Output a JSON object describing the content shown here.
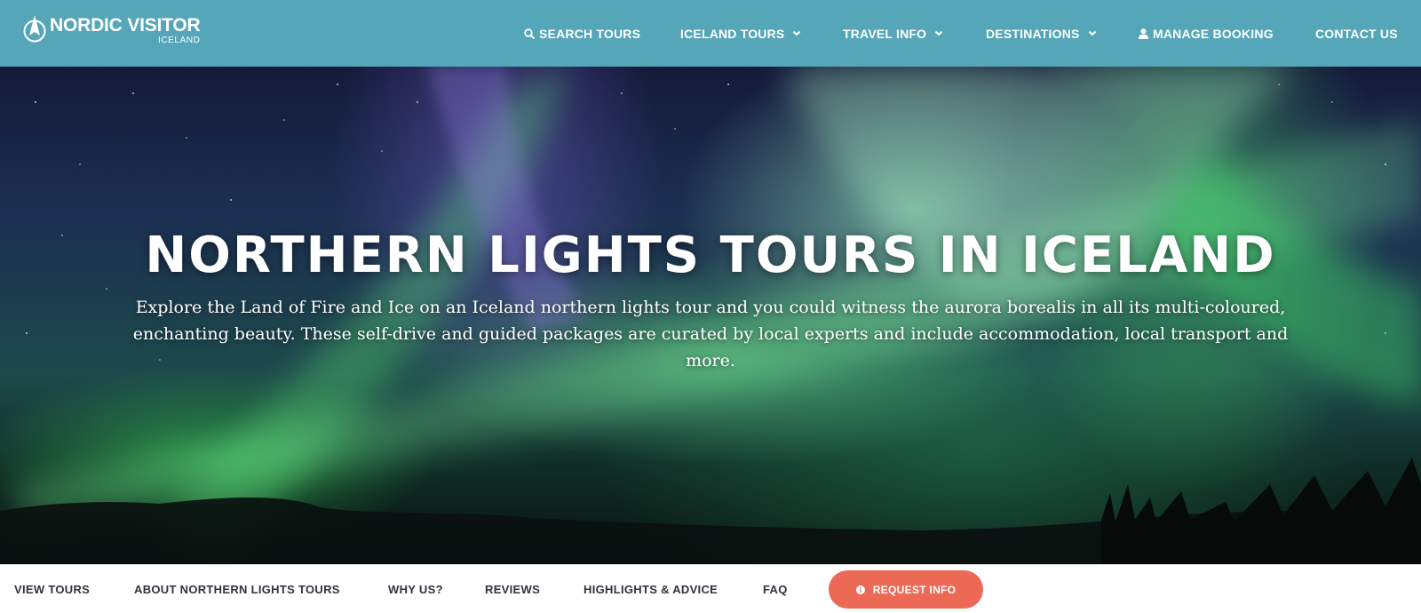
{
  "brand": {
    "name": "NORDIC VISITOR",
    "sub": "ICELAND"
  },
  "nav": {
    "search": {
      "label": "SEARCH TOURS",
      "icon": "search-icon"
    },
    "iceland_tours": {
      "label": "ICELAND TOURS",
      "icon": "chevron-down-icon"
    },
    "travel_info": {
      "label": "TRAVEL INFO",
      "icon": "chevron-down-icon"
    },
    "destinations": {
      "label": "DESTINATIONS",
      "icon": "chevron-down-icon"
    },
    "manage_booking": {
      "label": "MANAGE BOOKING",
      "icon": "user-icon"
    },
    "contact": {
      "label": "CONTACT US"
    }
  },
  "hero": {
    "title": "NORTHERN LIGHTS TOURS IN ICELAND",
    "description": "Explore the Land of Fire and Ice on an Iceland northern lights tour and you could witness the aurora borealis in all its multi-coloured, enchanting beauty. These self-drive and guided packages are curated by local experts and include accommodation, local transport and more."
  },
  "subnav": {
    "view_tours": "VIEW TOURS",
    "about": "ABOUT NORTHERN LIGHTS TOURS",
    "why_us": "WHY US?",
    "reviews": "REVIEWS",
    "highlights": "HIGHLIGHTS & ADVICE",
    "faq": "FAQ",
    "request_info": {
      "label": "REQUEST INFO",
      "icon": "info-icon"
    }
  },
  "colors": {
    "topbar": "#55a6b8",
    "cta": "#ec6a55",
    "subnav_text": "#2e3340"
  }
}
